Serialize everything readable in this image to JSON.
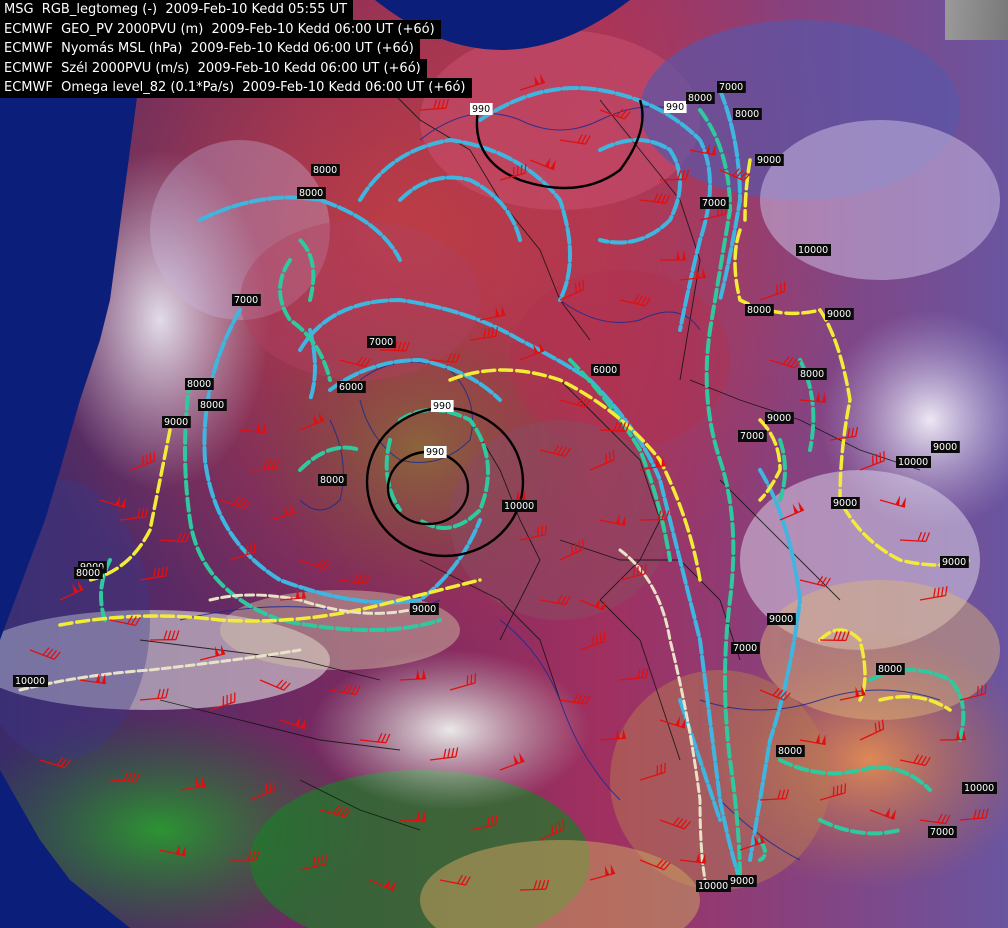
{
  "legend": {
    "lines": [
      "MSG  RGB_legtomeg (-)  2009-Feb-10 Kedd 05:55 UT",
      "ECMWF  GEO_PV 2000PVU (m)  2009-Feb-10 Kedd 06:00 UT (+6ó)",
      "ECMWF  Nyomás MSL (hPa)  2009-Feb-10 Kedd 06:00 UT (+6ó)",
      "ECMWF  Szél 2000PVU (m/s)  2009-Feb-10 Kedd 06:00 UT (+6ó)",
      "ECMWF  Omega level_82 (0.1*Pa/s)  2009-Feb-10 Kedd 06:00 UT (+6ó)"
    ]
  },
  "map": {
    "isobar_labels": [
      {
        "text": "990"
      },
      {
        "text": "990"
      },
      {
        "text": "990"
      },
      {
        "text": "990"
      }
    ],
    "contour_labels": [
      {
        "text": "7000"
      },
      {
        "text": "8000"
      },
      {
        "text": "8000"
      },
      {
        "text": "9000"
      },
      {
        "text": "10000"
      },
      {
        "text": "8000"
      },
      {
        "text": "8000"
      },
      {
        "text": "7000"
      },
      {
        "text": "7000"
      },
      {
        "text": "6000"
      },
      {
        "text": "8000"
      },
      {
        "text": "9000"
      },
      {
        "text": "8000"
      },
      {
        "text": "8000"
      },
      {
        "text": "9000"
      },
      {
        "text": "6000"
      },
      {
        "text": "8000"
      },
      {
        "text": "9000"
      },
      {
        "text": "7000"
      },
      {
        "text": "9000"
      },
      {
        "text": "8000"
      },
      {
        "text": "10000"
      },
      {
        "text": "9000"
      },
      {
        "text": "9000"
      },
      {
        "text": "9000"
      },
      {
        "text": "10000"
      },
      {
        "text": "7000"
      },
      {
        "text": "9000"
      },
      {
        "text": "8000"
      },
      {
        "text": "8000"
      },
      {
        "text": "9000"
      },
      {
        "text": "10000"
      },
      {
        "text": "7000"
      },
      {
        "text": "10000"
      },
      {
        "text": "9000"
      },
      {
        "text": "7000"
      },
      {
        "text": "8000"
      },
      {
        "text": "10000"
      }
    ]
  },
  "colors": {
    "ocean": "#0a1e7a",
    "isobar": "#000000",
    "geo_pv_cyan": "#3fb6e0",
    "geo_pv_teal": "#2fc9a0",
    "geo_pv_yellow": "#f2ec38",
    "geo_pv_light": "#e8e2c8",
    "wind_barb": "#e01010"
  }
}
